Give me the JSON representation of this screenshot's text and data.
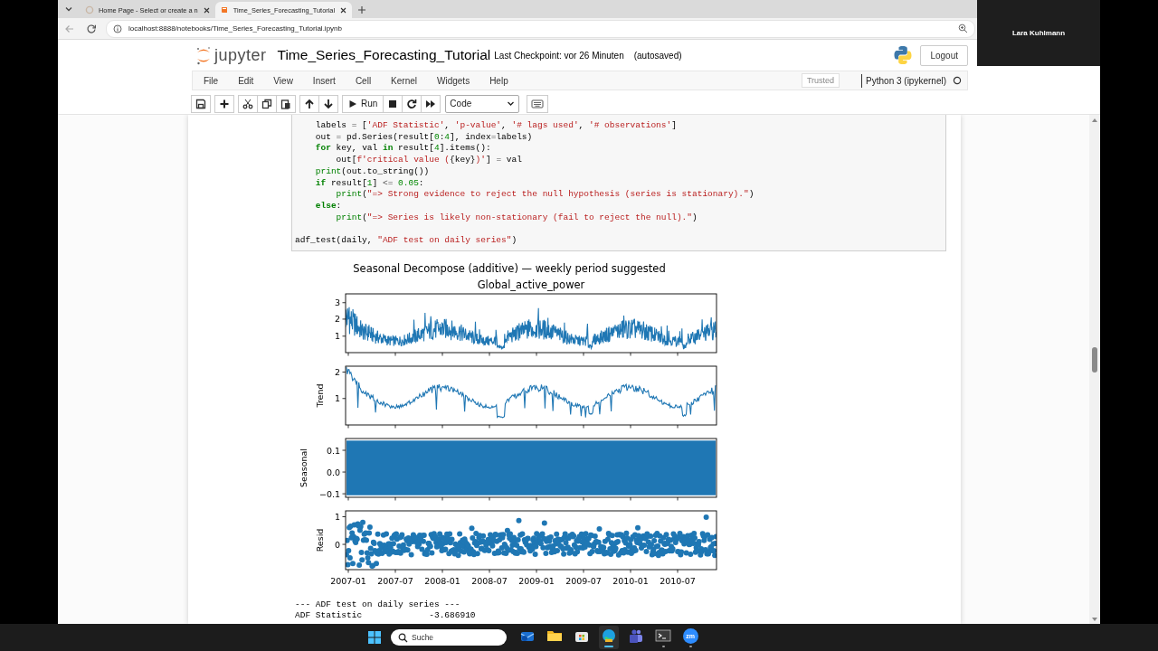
{
  "browser": {
    "tabs": [
      {
        "title": "Home Page - Select or create a n",
        "kind": "home",
        "selected": false
      },
      {
        "title": "Time_Series_Forecasting_Tutorial",
        "kind": "notebook",
        "selected": true
      }
    ],
    "url": "localhost:8888/notebooks/Time_Series_Forecasting_Tutorial.ipynb"
  },
  "video_tile": {
    "participant": "Lara Kuhlmann"
  },
  "notebook_header": {
    "logo_text": "jupyter",
    "title": "Time_Series_Forecasting_Tutorial",
    "checkpoint": "Last Checkpoint: vor 26 Minuten",
    "save_status": "(autosaved)",
    "logout": "Logout"
  },
  "menu": [
    "File",
    "Edit",
    "View",
    "Insert",
    "Cell",
    "Kernel",
    "Widgets",
    "Help"
  ],
  "toolbar": {
    "run": "Run",
    "cell_type": "Code",
    "trust": "Trusted",
    "kernel": "Python 3 (ipykernel)"
  },
  "code_cell": {
    "blocks": [
      [
        [
          {
            "kind": "plain",
            "text": "    labels "
          },
          {
            "kind": "op",
            "text": "="
          },
          {
            "kind": "plain",
            "text": " ["
          },
          {
            "kind": "str",
            "text": "'ADF Statistic'"
          },
          {
            "kind": "plain",
            "text": ", "
          },
          {
            "kind": "str",
            "text": "'p-value'"
          },
          {
            "kind": "plain",
            "text": ", "
          },
          {
            "kind": "str",
            "text": "'# lags used'"
          },
          {
            "kind": "plain",
            "text": ", "
          },
          {
            "kind": "str",
            "text": "'# observations'"
          },
          {
            "kind": "plain",
            "text": "]"
          }
        ],
        [
          {
            "kind": "plain",
            "text": "    out "
          },
          {
            "kind": "op",
            "text": "="
          },
          {
            "kind": "plain",
            "text": " pd.Series(result["
          },
          {
            "kind": "num",
            "text": "0"
          },
          {
            "kind": "plain",
            "text": ":"
          },
          {
            "kind": "num",
            "text": "4"
          },
          {
            "kind": "plain",
            "text": "], index"
          },
          {
            "kind": "op",
            "text": "="
          },
          {
            "kind": "plain",
            "text": "labels)"
          }
        ],
        [
          {
            "kind": "kw",
            "text": "    for"
          },
          {
            "kind": "plain",
            "text": " key, val "
          },
          {
            "kind": "kw",
            "text": "in"
          },
          {
            "kind": "plain",
            "text": " result["
          },
          {
            "kind": "num",
            "text": "4"
          },
          {
            "kind": "plain",
            "text": "].items():"
          }
        ],
        [
          {
            "kind": "plain",
            "text": "        out["
          },
          {
            "kind": "str",
            "text": "f'critical value ("
          },
          {
            "kind": "plain",
            "text": "{key}"
          },
          {
            "kind": "str",
            "text": ")'"
          },
          {
            "kind": "plain",
            "text": "] "
          },
          {
            "kind": "op",
            "text": "="
          },
          {
            "kind": "plain",
            "text": " val"
          }
        ],
        [
          {
            "kind": "builtin",
            "text": "    print"
          },
          {
            "kind": "plain",
            "text": "(out.to_string())"
          }
        ],
        [
          {
            "kind": "kw",
            "text": "    if"
          },
          {
            "kind": "plain",
            "text": " result["
          },
          {
            "kind": "num",
            "text": "1"
          },
          {
            "kind": "plain",
            "text": "] "
          },
          {
            "kind": "op",
            "text": "<="
          },
          {
            "kind": "num",
            "text": " 0.05"
          },
          {
            "kind": "plain",
            "text": ":"
          }
        ],
        [
          {
            "kind": "builtin",
            "text": "        print"
          },
          {
            "kind": "plain",
            "text": "("
          },
          {
            "kind": "str",
            "text": "\"=> Strong evidence to reject the null hypothesis (series is stationary).\""
          },
          {
            "kind": "plain",
            "text": ")"
          }
        ],
        [
          {
            "kind": "kw",
            "text": "    else"
          },
          {
            "kind": "plain",
            "text": ":"
          }
        ],
        [
          {
            "kind": "builtin",
            "text": "        print"
          },
          {
            "kind": "plain",
            "text": "("
          },
          {
            "kind": "str",
            "text": "\"=> Series is likely non-stationary (fail to reject the null).\""
          },
          {
            "kind": "plain",
            "text": ")"
          }
        ]
      ],
      [
        [
          {
            "kind": "plain",
            "text": "adf_test(daily, "
          },
          {
            "kind": "str",
            "text": "\"ADF test on daily series\""
          },
          {
            "kind": "plain",
            "text": ")"
          }
        ]
      ]
    ]
  },
  "output": {
    "figure": {
      "title": "Seasonal Decompose (additive) — weekly period suggested",
      "subtitle": "Global_active_power",
      "panels": [
        {
          "kind": "observed",
          "yticks": [
            "3",
            "2",
            "1"
          ]
        },
        {
          "kind": "trend",
          "ylabel": "Trend",
          "yticks": [
            "2",
            "1"
          ]
        },
        {
          "kind": "seasonal",
          "ylabel": "Seasonal",
          "yticks": [
            "0.1",
            "0.0",
            "−0.1"
          ]
        },
        {
          "kind": "resid",
          "ylabel": "Resid",
          "yticks": [
            "1",
            "0"
          ]
        }
      ],
      "xticks": [
        "2007-01",
        "2007-07",
        "2008-01",
        "2008-07",
        "2009-01",
        "2009-07",
        "2010-01",
        "2010-07"
      ]
    },
    "text": [
      "--- ADF test on daily series ---",
      "ADF Statistic             -3.686910"
    ]
  },
  "taskbar": {
    "search": {
      "placeholder": "Suche"
    },
    "apps": [
      {
        "kind": "mail",
        "selected": false,
        "running": false
      },
      {
        "kind": "files",
        "selected": false,
        "running": false
      },
      {
        "kind": "store",
        "selected": false,
        "running": false
      },
      {
        "kind": "browser",
        "selected": true,
        "running": true
      },
      {
        "kind": "teams",
        "selected": false,
        "running": false
      },
      {
        "kind": "terminal",
        "selected": false,
        "running": true
      },
      {
        "kind": "meeting",
        "label": "zm",
        "selected": false,
        "running": true
      }
    ]
  }
}
